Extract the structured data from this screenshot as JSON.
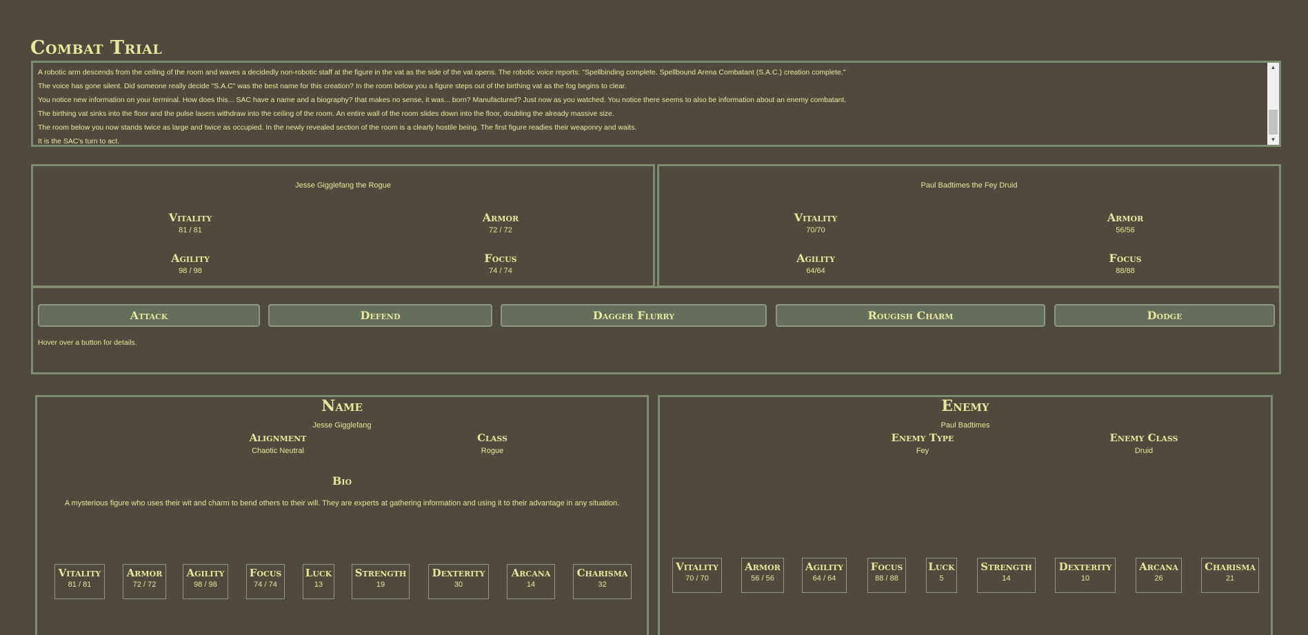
{
  "title": "Combat Trial",
  "log": [
    "A robotic arm descends from the ceiling of the room and waves a decidedly non-robotic staff at the figure in the vat as the side of the vat opens. The robotic voice reports: \"Spellbinding complete. Spellbound Arena Combatant (S.A.C.) creation complete.\"",
    "The voice has gone silent. Did someone really decide \"S.A.C\" was the best name for this creation? In the room below you a figure steps out of the birthing vat as the fog begins to clear.",
    "You notice new information on your terminal. How does this... SAC have a name and a biography? that makes no sense, it was... born? Manufactured? Just now as you watched. You notice there seems to also be information about an enemy combatant.",
    "The birthing vat sinks into the floor and the pulse lasers withdraw into the ceiling of the room. An entire wall of the room slides down into the floor, doubling the already massive size.",
    "The room below you now stands twice as large and twice as occupied. In the newly revealed section of the room is a clearly hostile being. The first figure readies their weaponry and waits.",
    "It is the SAC's turn to act."
  ],
  "player_panel": {
    "name": "Jesse Gigglefang the Rogue",
    "vitality_label": "Vitality",
    "vitality": "81 / 81",
    "armor_label": "Armor",
    "armor": "72 / 72",
    "agility_label": "Agility",
    "agility": "98 / 98",
    "focus_label": "Focus",
    "focus": "74 / 74"
  },
  "enemy_panel": {
    "name": "Paul Badtimes the Fey Druid",
    "vitality_label": "Vitality",
    "vitality": "70/70",
    "armor_label": "Armor",
    "armor": "56/56",
    "agility_label": "Agility",
    "agility": "64/64",
    "focus_label": "Focus",
    "focus": "88/88"
  },
  "actions": {
    "attack": "Attack",
    "defend": "Defend",
    "dagger_flurry": "Dagger Flurry",
    "rougish_charm": "Rougish Charm",
    "dodge": "Dodge",
    "hint": "Hover over a button for details."
  },
  "player_card": {
    "title": "Name",
    "name": "Jesse Gigglefang",
    "alignment_label": "Alignment",
    "alignment": "Chaotic Neutral",
    "class_label": "Class",
    "class": "Rogue",
    "bio_label": "Bio",
    "bio": "A mysterious figure who uses their wit and charm to bend others to their will. They are experts at gathering information and using it to their advantage in any situation.",
    "stats": [
      {
        "label": "Vitality",
        "value": "81 / 81"
      },
      {
        "label": "Armor",
        "value": "72 / 72"
      },
      {
        "label": "Agility",
        "value": "98 / 98"
      },
      {
        "label": "Focus",
        "value": "74 / 74"
      },
      {
        "label": "Luck",
        "value": "13"
      },
      {
        "label": "Strength",
        "value": "19"
      },
      {
        "label": "Dexterity",
        "value": "30"
      },
      {
        "label": "Arcana",
        "value": "14"
      },
      {
        "label": "Charisma",
        "value": "32"
      }
    ]
  },
  "enemy_card": {
    "title": "Enemy",
    "name": "Paul Badtimes",
    "type_label": "Enemy Type",
    "type": "Fey",
    "class_label": "Enemy Class",
    "class": "Druid",
    "stats": [
      {
        "label": "Vitality",
        "value": "70 / 70"
      },
      {
        "label": "Armor",
        "value": "56 / 56"
      },
      {
        "label": "Agility",
        "value": "64 / 64"
      },
      {
        "label": "Focus",
        "value": "88 / 88"
      },
      {
        "label": "Luck",
        "value": "5"
      },
      {
        "label": "Strength",
        "value": "14"
      },
      {
        "label": "Dexterity",
        "value": "10"
      },
      {
        "label": "Arcana",
        "value": "26"
      },
      {
        "label": "Charisma",
        "value": "21"
      }
    ]
  }
}
